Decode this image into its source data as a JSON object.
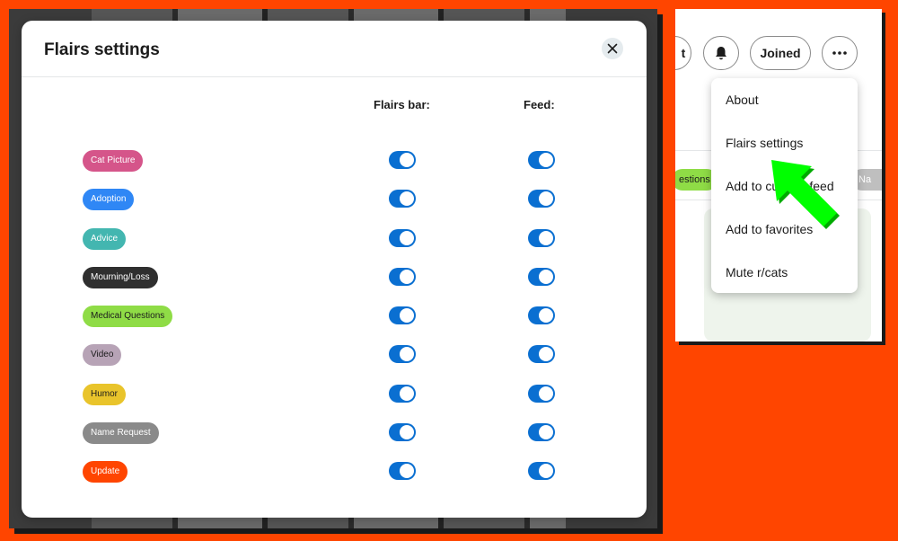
{
  "modal": {
    "title": "Flairs settings",
    "columns": {
      "flairs_bar": "Flairs bar:",
      "feed": "Feed:"
    },
    "flairs": [
      {
        "label": "Cat Picture",
        "color": "#d5558a",
        "flairs_bar": true,
        "feed": true
      },
      {
        "label": "Adoption",
        "color": "#2f87f5",
        "flairs_bar": true,
        "feed": true
      },
      {
        "label": "Advice",
        "color": "#43b6b0",
        "flairs_bar": true,
        "feed": true
      },
      {
        "label": "Mourning/Loss",
        "color": "#2f2f2f",
        "flairs_bar": true,
        "feed": true
      },
      {
        "label": "Medical Questions",
        "color": "#8fdc46",
        "flairs_bar": true,
        "feed": true
      },
      {
        "label": "Video",
        "color": "#b7a3b6",
        "flairs_bar": true,
        "feed": true
      },
      {
        "label": "Humor",
        "color": "#e9c42b",
        "flairs_bar": true,
        "feed": true
      },
      {
        "label": "Name Request",
        "color": "#8a8a8a",
        "flairs_bar": true,
        "feed": true
      },
      {
        "label": "Update",
        "color": "#ff4500",
        "flairs_bar": true,
        "feed": true
      }
    ]
  },
  "header_buttons": {
    "join_partial": "t",
    "joined": "Joined"
  },
  "chips": {
    "partial_left": "estions",
    "partial_right": "Na"
  },
  "dropdown": {
    "items": [
      "About",
      "Flairs settings",
      "Add to custom feed",
      "Add to favorites",
      "Mute r/cats"
    ]
  },
  "colors": {
    "accent": "#0a6fd1",
    "frame": "#ff4500",
    "arrow": "#00ff00"
  }
}
